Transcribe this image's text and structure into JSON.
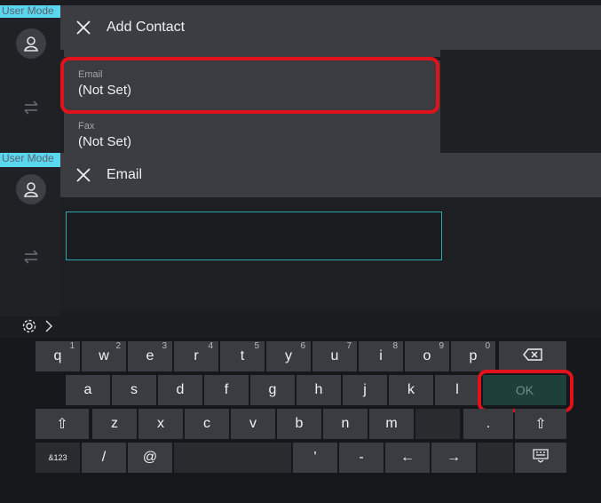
{
  "top_screen": {
    "mode_label": "User Mode",
    "title": "Add Contact",
    "fields": [
      {
        "label": "Email",
        "value": "(Not Set)"
      },
      {
        "label": "Fax",
        "value": "(Not Set)"
      }
    ]
  },
  "bottom_screen": {
    "mode_label": "User Mode",
    "title": "Email",
    "input_value": ""
  },
  "keyboard": {
    "row1": [
      {
        "key": "q",
        "sup": "1"
      },
      {
        "key": "w",
        "sup": "2"
      },
      {
        "key": "e",
        "sup": "3"
      },
      {
        "key": "r",
        "sup": "4"
      },
      {
        "key": "t",
        "sup": "5"
      },
      {
        "key": "y",
        "sup": "6"
      },
      {
        "key": "u",
        "sup": "7"
      },
      {
        "key": "i",
        "sup": "8"
      },
      {
        "key": "o",
        "sup": "9"
      },
      {
        "key": "p",
        "sup": "0"
      }
    ],
    "row2": [
      "a",
      "s",
      "d",
      "f",
      "g",
      "h",
      "j",
      "k",
      "l"
    ],
    "ok_label": "OK",
    "row3": [
      "z",
      "x",
      "c",
      "v",
      "b",
      "n",
      "m"
    ],
    "dot": ".",
    "slash": "/",
    "at": "@",
    "apostrophe": "'",
    "hyphen": "-",
    "left_arrow": "←",
    "right_arrow": "→",
    "shift": "⇧",
    "symbol_toggle": "&123"
  },
  "colors": {
    "accent_cyan": "#5ad6ee",
    "highlight_red": "#e0121b",
    "input_border": "#2ba6b3"
  }
}
